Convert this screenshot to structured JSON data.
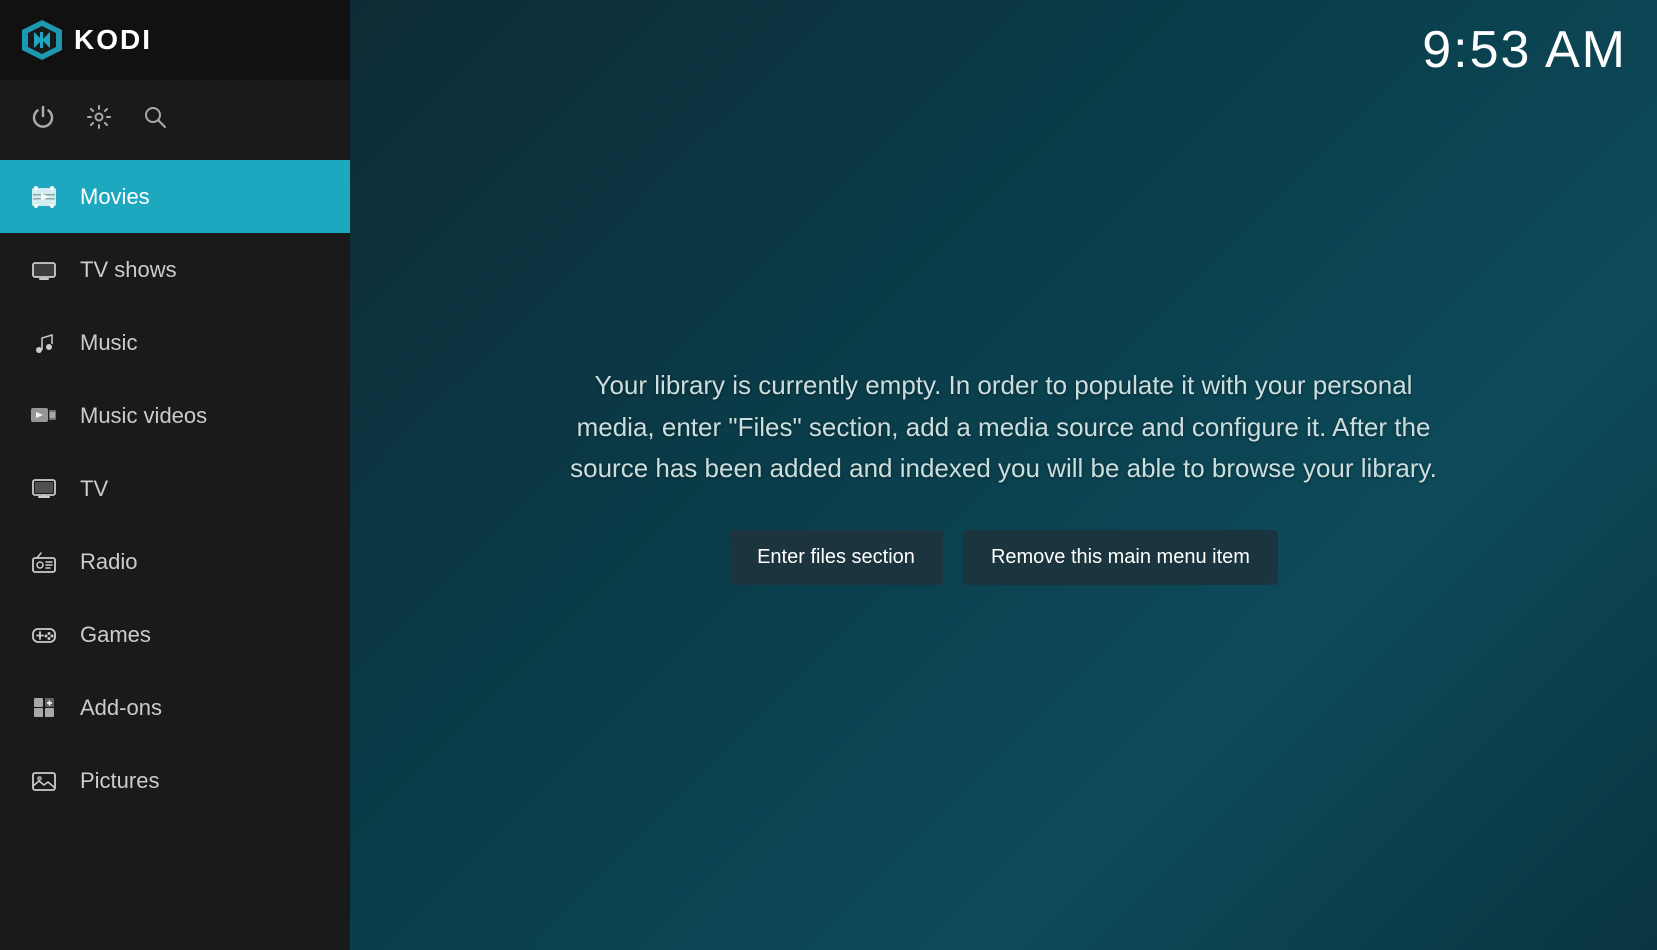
{
  "app": {
    "name": "KODI",
    "time": "9:53 AM"
  },
  "controls": [
    {
      "name": "power-icon",
      "symbol": "⏻",
      "label": "Power"
    },
    {
      "name": "settings-icon",
      "symbol": "⚙",
      "label": "Settings"
    },
    {
      "name": "search-icon",
      "symbol": "🔍",
      "label": "Search"
    }
  ],
  "nav": {
    "items": [
      {
        "id": "movies",
        "label": "Movies",
        "icon": "movies-icon",
        "active": true
      },
      {
        "id": "tv-shows",
        "label": "TV shows",
        "icon": "tv-shows-icon",
        "active": false
      },
      {
        "id": "music",
        "label": "Music",
        "icon": "music-icon",
        "active": false
      },
      {
        "id": "music-videos",
        "label": "Music videos",
        "icon": "music-videos-icon",
        "active": false
      },
      {
        "id": "tv",
        "label": "TV",
        "icon": "tv-icon",
        "active": false
      },
      {
        "id": "radio",
        "label": "Radio",
        "icon": "radio-icon",
        "active": false
      },
      {
        "id": "games",
        "label": "Games",
        "icon": "games-icon",
        "active": false
      },
      {
        "id": "add-ons",
        "label": "Add-ons",
        "icon": "add-ons-icon",
        "active": false
      },
      {
        "id": "pictures",
        "label": "Pictures",
        "icon": "pictures-icon",
        "active": false
      }
    ]
  },
  "main": {
    "library_message": "Your library is currently empty. In order to populate it with your personal media, enter \"Files\" section, add a media source and configure it. After the source has been added and indexed you will be able to browse your library.",
    "buttons": {
      "enter_files": "Enter files section",
      "remove_menu_item": "Remove this main menu item"
    }
  }
}
